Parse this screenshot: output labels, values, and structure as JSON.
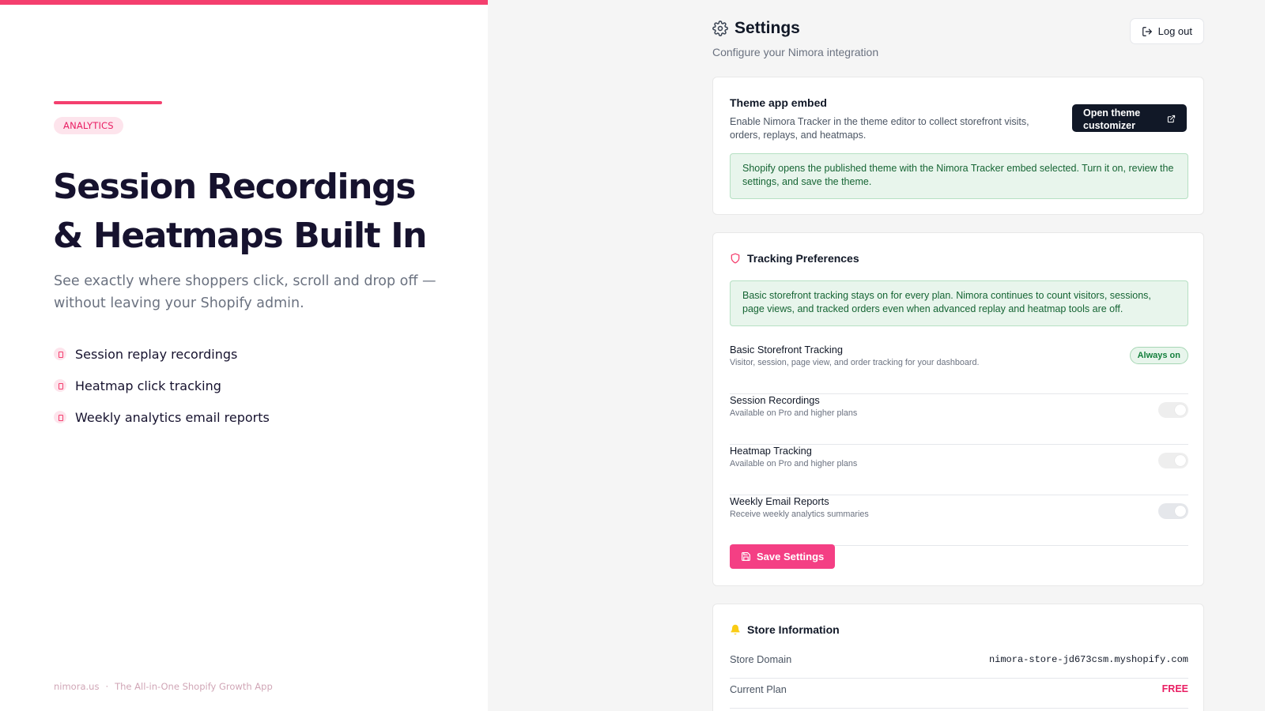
{
  "colors": {
    "accent": "#f43f6e",
    "heading": "#16122e",
    "success_bg": "#e8f5ec",
    "success_text": "#166534",
    "button_dark": "#111827",
    "save_button": "#f43f84"
  },
  "marketing": {
    "kicker": "ANALYTICS",
    "title_line1": "Session Recordings",
    "title_line2": "& Heatmaps Built In",
    "subtitle": "See exactly where shoppers click, scroll and drop off — without leaving your Shopify admin.",
    "features": [
      {
        "label": "Session replay recordings"
      },
      {
        "label": "Heatmap click tracking"
      },
      {
        "label": "Weekly analytics email reports"
      }
    ],
    "footer": {
      "site": "nimora.us",
      "separator": "·",
      "tagline": "The All-in-One Shopify Growth App"
    }
  },
  "app": {
    "header": {
      "title": "Settings",
      "subtitle": "Configure your Nimora integration",
      "logout_label": "Log out",
      "icon": "gear-icon"
    },
    "theme_embed": {
      "title": "Theme app embed",
      "description": "Enable Nimora Tracker in the theme editor to collect storefront visits, orders, replays, and heatmaps.",
      "button_label": "Open theme customizer",
      "notice": "Shopify opens the published theme with the Nimora Tracker embed selected. Turn it on, review the settings, and save the theme."
    },
    "tracking": {
      "title": "Tracking Preferences",
      "icon": "shield-icon",
      "notice": "Basic storefront tracking stays on for every plan. Nimora continues to count visitors, sessions, page views, and tracked orders even when advanced replay and heatmap tools are off.",
      "basic": {
        "name": "Basic Storefront Tracking",
        "description": "Visitor, session, page view, and order tracking for your dashboard.",
        "badge": "Always on"
      },
      "options": [
        {
          "name": "Session Recordings",
          "description": "Available on Pro and higher plans",
          "enabled": false
        },
        {
          "name": "Heatmap Tracking",
          "description": "Available on Pro and higher plans",
          "enabled": false
        },
        {
          "name": "Weekly Email Reports",
          "description": "Receive weekly analytics summaries",
          "enabled": false
        }
      ],
      "save_label": "Save Settings"
    },
    "store": {
      "title": "Store Information",
      "icon": "bell-icon",
      "domain_label": "Store Domain",
      "domain_value": "nimora-store-jd673csm.myshopify.com",
      "plan_label": "Current Plan",
      "plan_value": "FREE"
    }
  }
}
